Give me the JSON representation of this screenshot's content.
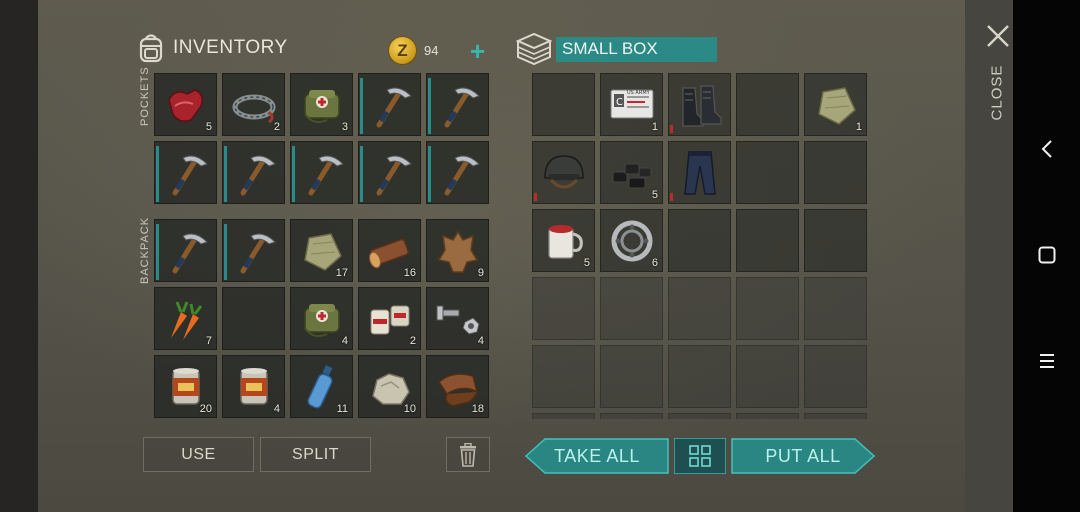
{
  "inventory": {
    "title": "INVENTORY",
    "coins": "94",
    "coin_symbol": "Z",
    "add_coins": "+"
  },
  "sections": {
    "pockets": "POCKETS",
    "backpack": "BACKPACK"
  },
  "box": {
    "title": "SMALL BOX"
  },
  "close": {
    "label": "CLOSE"
  },
  "buttons": {
    "use": "USE",
    "split": "SPLIT",
    "take_all": "TAKE ALL",
    "put_all": "PUT ALL"
  },
  "pockets": [
    {
      "item": "raw-meat",
      "qty": "5"
    },
    {
      "item": "rope",
      "qty": "2"
    },
    {
      "item": "first-aid-bag",
      "qty": "3"
    },
    {
      "item": "pickaxe",
      "qty": ""
    },
    {
      "item": "pickaxe",
      "qty": ""
    },
    {
      "item": "pickaxe",
      "qty": ""
    },
    {
      "item": "pickaxe",
      "qty": ""
    },
    {
      "item": "pickaxe",
      "qty": ""
    },
    {
      "item": "pickaxe",
      "qty": ""
    },
    {
      "item": "pickaxe",
      "qty": ""
    }
  ],
  "backpack": [
    {
      "item": "pickaxe",
      "qty": ""
    },
    {
      "item": "pickaxe",
      "qty": ""
    },
    {
      "item": "cloth",
      "qty": "17"
    },
    {
      "item": "log",
      "qty": "16"
    },
    {
      "item": "leather",
      "qty": "9"
    },
    {
      "item": "carrot",
      "qty": "7"
    },
    {
      "item": "empty",
      "qty": ""
    },
    {
      "item": "first-aid-bag",
      "qty": "4"
    },
    {
      "item": "bandage",
      "qty": "2"
    },
    {
      "item": "bolt-nut",
      "qty": "4"
    },
    {
      "item": "canned-food",
      "qty": "20"
    },
    {
      "item": "canned-food",
      "qty": "4"
    },
    {
      "item": "water-bottle",
      "qty": "11"
    },
    {
      "item": "stone",
      "qty": "10"
    },
    {
      "item": "tanned-leather",
      "qty": "18"
    }
  ],
  "box_items": [
    {
      "item": "empty",
      "qty": ""
    },
    {
      "item": "id-card",
      "qty": "1",
      "card_text": "US ARMY"
    },
    {
      "item": "boots",
      "qty": ""
    },
    {
      "item": "empty",
      "qty": ""
    },
    {
      "item": "cloth",
      "qty": "1"
    },
    {
      "item": "helmet",
      "qty": ""
    },
    {
      "item": "coal",
      "qty": "5"
    },
    {
      "item": "pants",
      "qty": ""
    },
    {
      "item": "empty",
      "qty": ""
    },
    {
      "item": "empty",
      "qty": ""
    },
    {
      "item": "mug",
      "qty": "5"
    },
    {
      "item": "bearing",
      "qty": "6"
    },
    {
      "item": "empty",
      "qty": ""
    },
    {
      "item": "empty",
      "qty": ""
    },
    {
      "item": "empty",
      "qty": ""
    }
  ],
  "colors": {
    "accent": "#2b8a86",
    "coin": "#e0b12c",
    "panel": "#26282a"
  }
}
